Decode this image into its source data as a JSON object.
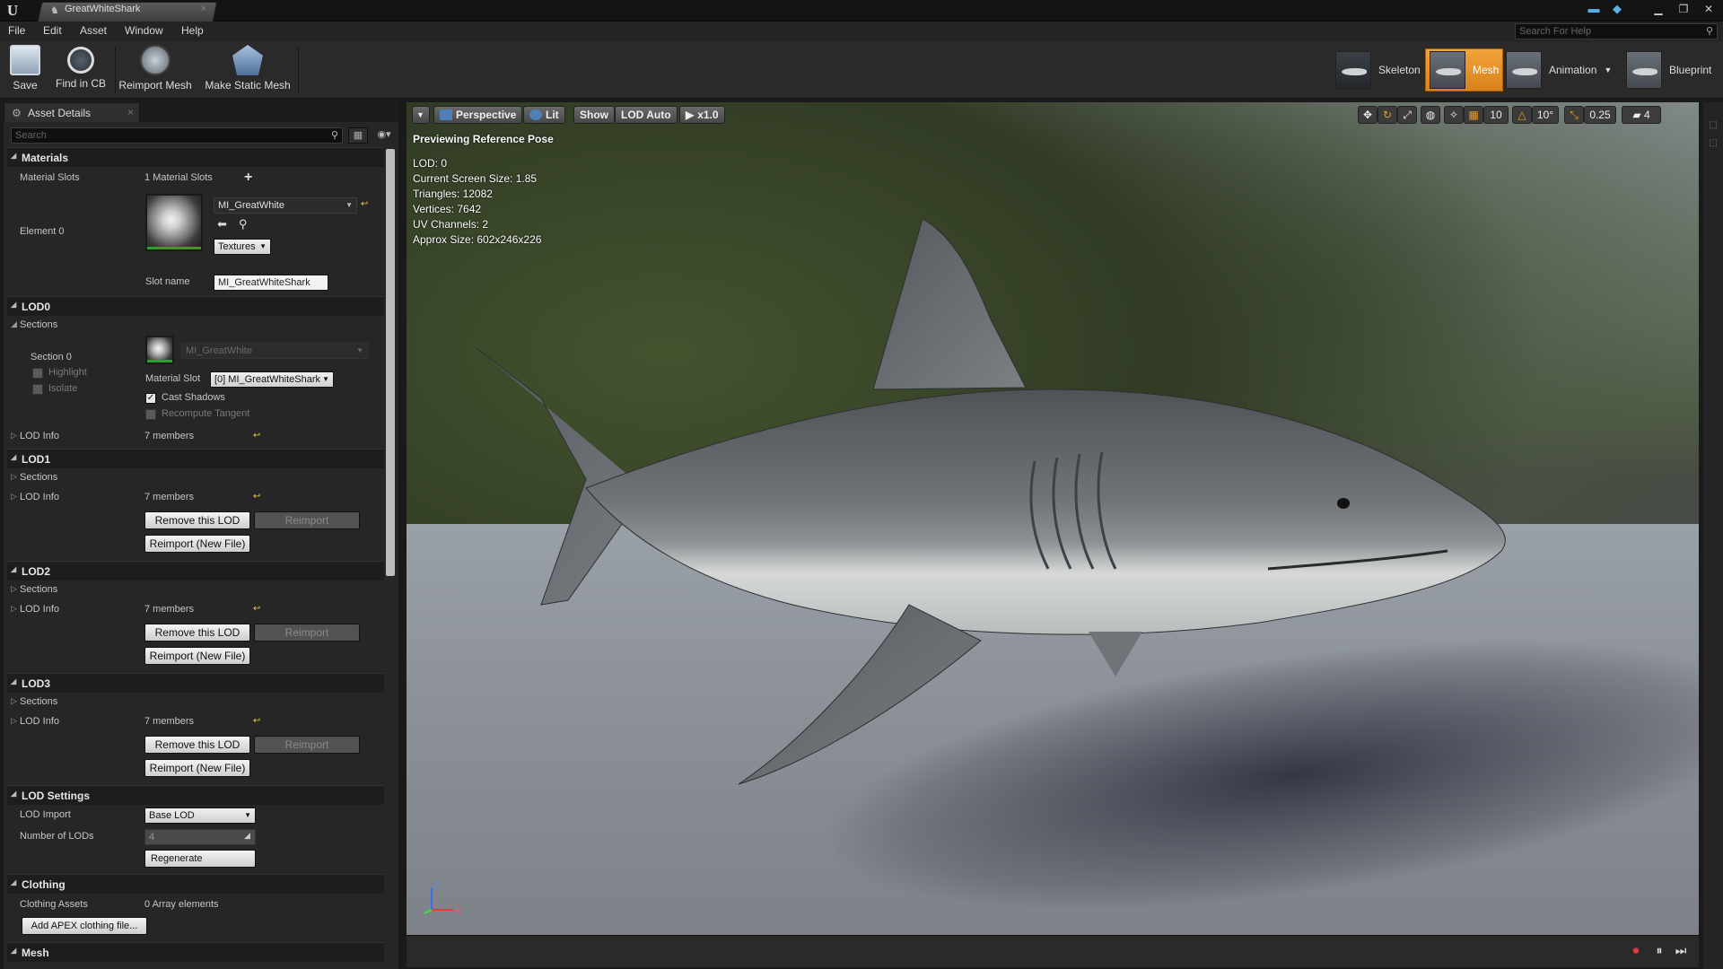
{
  "window": {
    "tab_title": "GreatWhiteShark",
    "search_help_placeholder": "Search For Help"
  },
  "menu": [
    "File",
    "Edit",
    "Asset",
    "Window",
    "Help"
  ],
  "toolbar": {
    "save": "Save",
    "find_in_cb": "Find in CB",
    "reimport_mesh": "Reimport Mesh",
    "make_static_mesh": "Make Static Mesh"
  },
  "modes": {
    "skeleton": "Skeleton",
    "mesh": "Mesh",
    "animation": "Animation",
    "blueprint": "Blueprint"
  },
  "details": {
    "tab_label": "Asset Details",
    "search_placeholder": "Search",
    "materials": {
      "header": "Materials",
      "slots_label": "Material Slots",
      "slots_value": "1 Material Slots",
      "element_label": "Element 0",
      "material_name": "MI_GreatWhite",
      "textures_label": "Textures",
      "slot_name_label": "Slot name",
      "slot_name_value": "MI_GreatWhiteShark"
    },
    "lod0": {
      "header": "LOD0",
      "sections": "Sections",
      "section0": "Section 0",
      "highlight": "Highlight",
      "isolate": "Isolate",
      "material_ghost": "MI_GreatWhite",
      "material_slot_label": "Material Slot",
      "material_slot_value": "[0] MI_GreatWhiteShark",
      "cast_shadows": "Cast Shadows",
      "recompute_tangent": "Recompute Tangent",
      "lod_info": "LOD Info",
      "lod_info_value": "7 members"
    },
    "lod1": {
      "header": "LOD1",
      "sections": "Sections",
      "lod_info": "LOD Info",
      "lod_info_value": "7 members",
      "remove": "Remove this LOD",
      "reimport": "Reimport",
      "reimport_new": "Reimport (New File)"
    },
    "lod2": {
      "header": "LOD2",
      "sections": "Sections",
      "lod_info": "LOD Info",
      "lod_info_value": "7 members",
      "remove": "Remove this LOD",
      "reimport": "Reimport",
      "reimport_new": "Reimport (New File)"
    },
    "lod3": {
      "header": "LOD3",
      "sections": "Sections",
      "lod_info": "LOD Info",
      "lod_info_value": "7 members",
      "remove": "Remove this LOD",
      "reimport": "Reimport",
      "reimport_new": "Reimport (New File)"
    },
    "lod_settings": {
      "header": "LOD Settings",
      "lod_import_label": "LOD Import",
      "lod_import_value": "Base LOD",
      "num_lods_label": "Number of LODs",
      "num_lods_value": "4",
      "regenerate": "Regenerate"
    },
    "clothing": {
      "header": "Clothing",
      "assets_label": "Clothing Assets",
      "assets_value": "0 Array elements",
      "add_button": "Add APEX clothing file..."
    },
    "mesh_header": "Mesh"
  },
  "viewport": {
    "perspective": "Perspective",
    "lit": "Lit",
    "show": "Show",
    "lod_auto": "LOD Auto",
    "speed": "x1.0",
    "grid_snap": "10",
    "rot_snap": "10°",
    "scale_snap": "0.25",
    "cam_speed": "4",
    "preview_label": "Previewing Reference Pose",
    "stats": [
      "LOD: 0",
      "Current Screen Size: 1.85",
      "Triangles: 12082",
      "Vertices: 7642",
      "UV Channels: 2",
      "Approx Size: 602x246x226"
    ],
    "axis_z": "Z",
    "axis_x": "X"
  },
  "colors": {
    "accent_orange": "#e8922a",
    "record_red": "#e03a3a",
    "panel_bg": "#262626"
  }
}
